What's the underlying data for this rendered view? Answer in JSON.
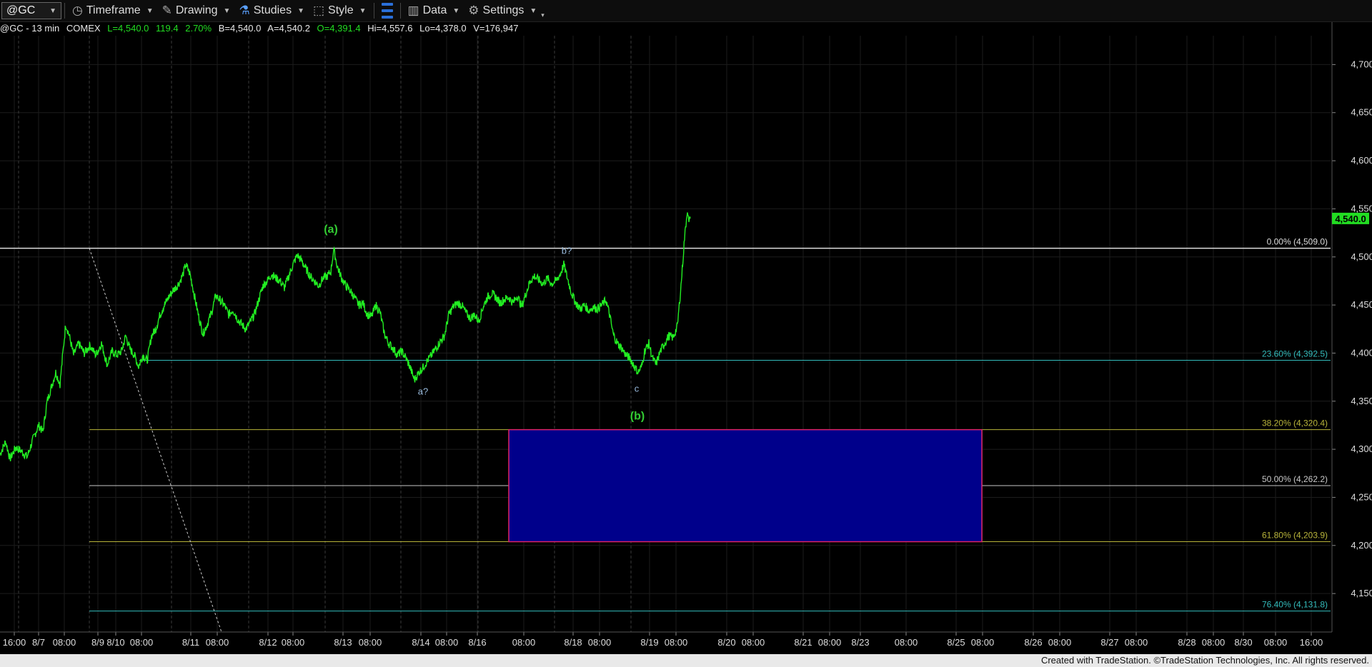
{
  "toolbar": {
    "symbol": "@GC",
    "timeframe_label": "Timeframe",
    "drawing_label": "Drawing",
    "studies_label": "Studies",
    "style_label": "Style",
    "data_label": "Data",
    "settings_label": "Settings"
  },
  "infobar": {
    "title": "@GC - 13 min",
    "exchange": "COMEX",
    "last": "L=4,540.0",
    "change": "119.4",
    "change_pct": "2.70%",
    "bid": "B=4,540.0",
    "ask": "A=4,540.2",
    "open": "O=4,391.4",
    "high": "Hi=4,557.6",
    "low": "Lo=4,378.0",
    "volume": "V=176,947"
  },
  "chart_data": {
    "type": "line",
    "y_range": [
      4110,
      4730
    ],
    "y_ticks": [
      {
        "value": 4700,
        "label": "4,700.0"
      },
      {
        "value": 4650,
        "label": "4,650.0"
      },
      {
        "value": 4600,
        "label": "4,600.0"
      },
      {
        "value": 4550,
        "label": "4,550.0"
      },
      {
        "value": 4500,
        "label": "4,500.0"
      },
      {
        "value": 4450,
        "label": "4,450.0"
      },
      {
        "value": 4400,
        "label": "4,400.0"
      },
      {
        "value": 4350,
        "label": "4,350.0"
      },
      {
        "value": 4300,
        "label": "4,300.0"
      },
      {
        "value": 4250,
        "label": "4,250.0"
      },
      {
        "value": 4200,
        "label": "4,200.0"
      },
      {
        "value": 4150,
        "label": "4,150.0"
      }
    ],
    "x_range": [
      0,
      1862
    ],
    "x_ticks": [
      {
        "x": 20,
        "label": "16:00"
      },
      {
        "x": 54,
        "label": "8/7"
      },
      {
        "x": 90,
        "label": "08:00"
      },
      {
        "x": 137,
        "label": "8/9"
      },
      {
        "x": 162,
        "label": "8/10"
      },
      {
        "x": 198,
        "label": "08:00"
      },
      {
        "x": 267,
        "label": "8/11"
      },
      {
        "x": 304,
        "label": "08:00"
      },
      {
        "x": 375,
        "label": "8/12"
      },
      {
        "x": 410,
        "label": "08:00"
      },
      {
        "x": 480,
        "label": "8/13"
      },
      {
        "x": 518,
        "label": "08:00"
      },
      {
        "x": 589,
        "label": "8/14"
      },
      {
        "x": 625,
        "label": "08:00"
      },
      {
        "x": 668,
        "label": "8/16"
      },
      {
        "x": 733,
        "label": "08:00"
      },
      {
        "x": 802,
        "label": "8/18"
      },
      {
        "x": 839,
        "label": "08:00"
      },
      {
        "x": 909,
        "label": "8/19"
      },
      {
        "x": 946,
        "label": "08:00"
      },
      {
        "x": 1017,
        "label": "8/20"
      },
      {
        "x": 1054,
        "label": "08:00"
      },
      {
        "x": 1124,
        "label": "8/21"
      },
      {
        "x": 1161,
        "label": "08:00"
      },
      {
        "x": 1204,
        "label": "8/23"
      },
      {
        "x": 1268,
        "label": "08:00"
      },
      {
        "x": 1338,
        "label": "8/25"
      },
      {
        "x": 1375,
        "label": "08:00"
      },
      {
        "x": 1446,
        "label": "8/26"
      },
      {
        "x": 1483,
        "label": "08:00"
      },
      {
        "x": 1553,
        "label": "8/27"
      },
      {
        "x": 1590,
        "label": "08:00"
      },
      {
        "x": 1661,
        "label": "8/28"
      },
      {
        "x": 1698,
        "label": "08:00"
      },
      {
        "x": 1740,
        "label": "8/30"
      },
      {
        "x": 1785,
        "label": "08:00"
      },
      {
        "x": 1835,
        "label": "16:00"
      }
    ],
    "session_separators": [
      26,
      125,
      240,
      348,
      455,
      561,
      669,
      776,
      883
    ],
    "series": [
      {
        "color": "#22ee22",
        "points": [
          [
            0,
            4295
          ],
          [
            8,
            4308
          ],
          [
            14,
            4290
          ],
          [
            22,
            4302
          ],
          [
            30,
            4298
          ],
          [
            38,
            4292
          ],
          [
            46,
            4310
          ],
          [
            54,
            4325
          ],
          [
            60,
            4318
          ],
          [
            66,
            4350
          ],
          [
            72,
            4365
          ],
          [
            78,
            4380
          ],
          [
            84,
            4368
          ],
          [
            88,
            4400
          ],
          [
            92,
            4430
          ],
          [
            97,
            4418
          ],
          [
            103,
            4398
          ],
          [
            110,
            4410
          ],
          [
            118,
            4400
          ],
          [
            126,
            4408
          ],
          [
            134,
            4398
          ],
          [
            142,
            4410
          ],
          [
            150,
            4388
          ],
          [
            157,
            4402
          ],
          [
            164,
            4398
          ],
          [
            170,
            4402
          ],
          [
            176,
            4418
          ],
          [
            182,
            4404
          ],
          [
            188,
            4398
          ],
          [
            194,
            4386
          ],
          [
            200,
            4398
          ],
          [
            206,
            4392
          ],
          [
            212,
            4418
          ],
          [
            218,
            4425
          ],
          [
            224,
            4440
          ],
          [
            230,
            4450
          ],
          [
            236,
            4458
          ],
          [
            242,
            4465
          ],
          [
            248,
            4470
          ],
          [
            252,
            4475
          ],
          [
            256,
            4482
          ],
          [
            260,
            4492
          ],
          [
            266,
            4482
          ],
          [
            272,
            4460
          ],
          [
            278,
            4438
          ],
          [
            284,
            4420
          ],
          [
            290,
            4430
          ],
          [
            296,
            4442
          ],
          [
            302,
            4460
          ],
          [
            308,
            4455
          ],
          [
            314,
            4450
          ],
          [
            320,
            4440
          ],
          [
            326,
            4445
          ],
          [
            332,
            4436
          ],
          [
            338,
            4430
          ],
          [
            344,
            4425
          ],
          [
            350,
            4432
          ],
          [
            356,
            4440
          ],
          [
            362,
            4455
          ],
          [
            368,
            4470
          ],
          [
            374,
            4475
          ],
          [
            380,
            4482
          ],
          [
            386,
            4478
          ],
          [
            392,
            4475
          ],
          [
            398,
            4468
          ],
          [
            404,
            4480
          ],
          [
            410,
            4492
          ],
          [
            416,
            4502
          ],
          [
            422,
            4496
          ],
          [
            428,
            4488
          ],
          [
            434,
            4480
          ],
          [
            440,
            4475
          ],
          [
            446,
            4470
          ],
          [
            452,
            4478
          ],
          [
            458,
            4480
          ],
          [
            463,
            4485
          ],
          [
            467,
            4508
          ],
          [
            472,
            4490
          ],
          [
            478,
            4478
          ],
          [
            484,
            4470
          ],
          [
            490,
            4465
          ],
          [
            496,
            4458
          ],
          [
            502,
            4450
          ],
          [
            508,
            4452
          ],
          [
            514,
            4440
          ],
          [
            520,
            4438
          ],
          [
            526,
            4450
          ],
          [
            532,
            4442
          ],
          [
            538,
            4420
          ],
          [
            544,
            4410
          ],
          [
            550,
            4405
          ],
          [
            556,
            4398
          ],
          [
            562,
            4402
          ],
          [
            568,
            4395
          ],
          [
            574,
            4385
          ],
          [
            580,
            4372
          ],
          [
            586,
            4380
          ],
          [
            592,
            4385
          ],
          [
            598,
            4392
          ],
          [
            604,
            4398
          ],
          [
            610,
            4405
          ],
          [
            616,
            4412
          ],
          [
            622,
            4418
          ],
          [
            628,
            4440
          ],
          [
            634,
            4448
          ],
          [
            640,
            4452
          ],
          [
            646,
            4450
          ],
          [
            652,
            4442
          ],
          [
            658,
            4436
          ],
          [
            664,
            4440
          ],
          [
            670,
            4433
          ],
          [
            676,
            4448
          ],
          [
            682,
            4458
          ],
          [
            688,
            4462
          ],
          [
            694,
            4458
          ],
          [
            700,
            4452
          ],
          [
            706,
            4456
          ],
          [
            712,
            4458
          ],
          [
            718,
            4452
          ],
          [
            724,
            4460
          ],
          [
            730,
            4448
          ],
          [
            736,
            4462
          ],
          [
            742,
            4475
          ],
          [
            748,
            4480
          ],
          [
            754,
            4476
          ],
          [
            760,
            4472
          ],
          [
            766,
            4478
          ],
          [
            772,
            4472
          ],
          [
            778,
            4475
          ],
          [
            784,
            4482
          ],
          [
            789,
            4492
          ],
          [
            794,
            4478
          ],
          [
            800,
            4462
          ],
          [
            806,
            4452
          ],
          [
            812,
            4446
          ],
          [
            818,
            4450
          ],
          [
            824,
            4444
          ],
          [
            830,
            4448
          ],
          [
            836,
            4446
          ],
          [
            842,
            4450
          ],
          [
            848,
            4455
          ],
          [
            853,
            4440
          ],
          [
            858,
            4420
          ],
          [
            864,
            4410
          ],
          [
            870,
            4405
          ],
          [
            876,
            4398
          ],
          [
            882,
            4394
          ],
          [
            888,
            4386
          ],
          [
            893,
            4380
          ],
          [
            898,
            4386
          ],
          [
            902,
            4402
          ],
          [
            908,
            4410
          ],
          [
            913,
            4395
          ],
          [
            918,
            4388
          ],
          [
            924,
            4402
          ],
          [
            930,
            4410
          ],
          [
            936,
            4418
          ],
          [
            942,
            4416
          ],
          [
            948,
            4428
          ],
          [
            950,
            4445
          ],
          [
            953,
            4470
          ],
          [
            956,
            4500
          ],
          [
            958,
            4520
          ],
          [
            960,
            4535
          ],
          [
            962,
            4550
          ],
          [
            964,
            4535
          ],
          [
            966,
            4540
          ]
        ]
      }
    ],
    "fib_levels": [
      {
        "value": 4509.0,
        "label": "0.00% (4,509.0)",
        "color": "#dcdcdc",
        "x_start": 0
      },
      {
        "value": 4392.5,
        "label": "23.60% (4,392.5)",
        "color": "#33bbbb",
        "x_start": 195
      },
      {
        "value": 4320.4,
        "label": "38.20% (4,320.4)",
        "color": "#b8b43a",
        "x_start": 125
      },
      {
        "value": 4262.2,
        "label": "50.00% (4,262.2)",
        "color": "#c8c8c8",
        "x_start": 125
      },
      {
        "value": 4203.9,
        "label": "61.80% (4,203.9)",
        "color": "#b8b43a",
        "x_start": 125
      },
      {
        "value": 4131.8,
        "label": "76.40% (4,131.8)",
        "color": "#33bbbb",
        "x_start": 125
      }
    ],
    "target_box": {
      "x_start": 712,
      "x_end": 1374,
      "y_top": 4320.4,
      "y_bottom": 4203.9,
      "fill": "#00008b",
      "border": "#dd2266"
    },
    "trend_line": {
      "from": [
        125,
        4509
      ],
      "to": [
        310,
        4110
      ],
      "color": "#cccccc"
    },
    "last_price": {
      "value": 4540.0,
      "label": "4,540.0",
      "color": "#22dd22"
    },
    "wave_labels": [
      {
        "text": "(a)",
        "x": 463,
        "y": 4525,
        "color": "#33cc33",
        "style": "major"
      },
      {
        "text": "b?",
        "x": 793,
        "y": 4503,
        "color": "#99bbdd",
        "style": "minor"
      },
      {
        "text": "a?",
        "x": 592,
        "y": 4357,
        "color": "#99bbdd",
        "style": "minor"
      },
      {
        "text": "c",
        "x": 891,
        "y": 4360,
        "color": "#99bbdd",
        "style": "minor"
      },
      {
        "text": "(b)",
        "x": 892,
        "y": 4331,
        "color": "#33cc33",
        "style": "major"
      }
    ]
  },
  "footer": {
    "credit": "Created with TradeStation. ©TradeStation Technologies, Inc. All rights reserved."
  }
}
